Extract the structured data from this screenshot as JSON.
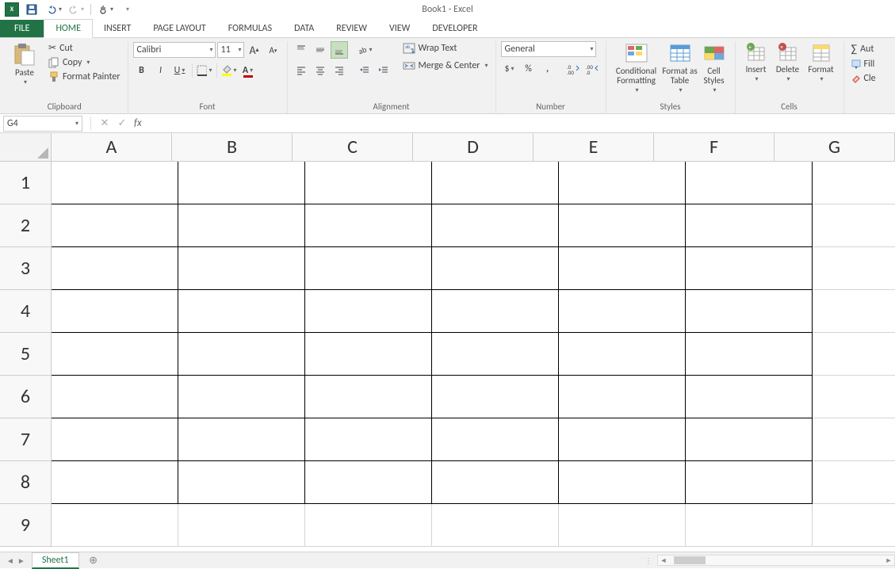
{
  "title": "Book1 - Excel",
  "qat": {
    "save": "💾",
    "undo": "↶",
    "redo": "↷",
    "touch": "👆"
  },
  "tabs": {
    "file": "FILE",
    "home": "HOME",
    "insert": "INSERT",
    "page_layout": "PAGE LAYOUT",
    "formulas": "FORMULAS",
    "data": "DATA",
    "review": "REVIEW",
    "view": "VIEW",
    "developer": "DEVELOPER"
  },
  "ribbon": {
    "clipboard": {
      "paste": "Paste",
      "cut": "Cut",
      "copy": "Copy",
      "format_painter": "Format Painter",
      "label": "Clipboard"
    },
    "font": {
      "name": "Calibri",
      "size": "11",
      "bold": "B",
      "italic": "I",
      "underline": "U",
      "label": "Font",
      "grow": "A",
      "shrink": "A"
    },
    "alignment": {
      "label": "Alignment",
      "wrap": "Wrap Text",
      "merge": "Merge & Center"
    },
    "number": {
      "label": "Number",
      "format": "General",
      "currency": "$",
      "percent": "%",
      "comma": ",",
      "inc": "◎",
      "dec": "◎"
    },
    "styles": {
      "label": "Styles",
      "cond": "Conditional Formatting",
      "table": "Format as Table",
      "cell": "Cell Styles"
    },
    "cells": {
      "label": "Cells",
      "insert": "Insert",
      "delete": "Delete",
      "format": "Format"
    },
    "editing": {
      "autosum": "Aut",
      "fill": "Fill",
      "clear": "Cle"
    }
  },
  "formula_bar": {
    "name_box": "G4",
    "fx": "fx"
  },
  "grid": {
    "columns": [
      "A",
      "B",
      "C",
      "D",
      "E",
      "F",
      "G"
    ],
    "rows": [
      "1",
      "2",
      "3",
      "4",
      "5",
      "6",
      "7",
      "8",
      "9"
    ],
    "bordered_cols": 6,
    "bordered_rows": 8
  },
  "sheet_tabs": {
    "sheet": "Sheet1",
    "add": "⊕"
  }
}
